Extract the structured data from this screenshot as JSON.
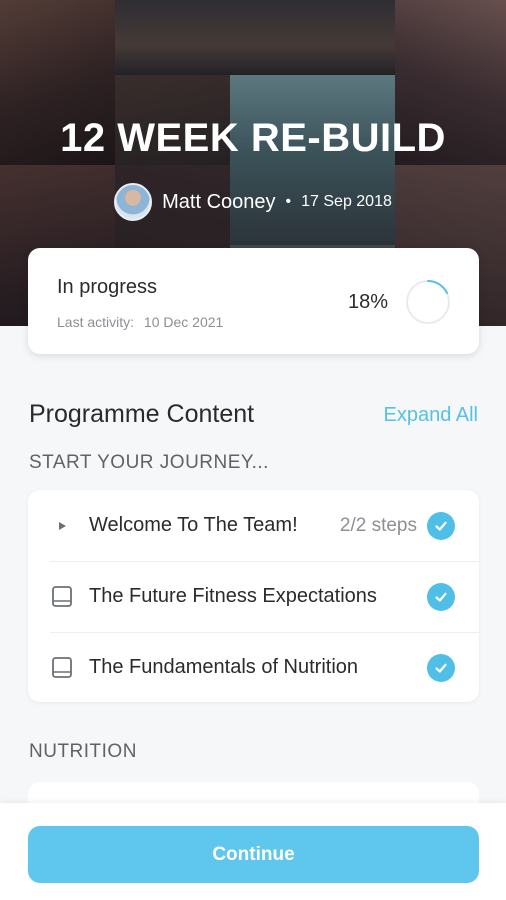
{
  "programme": {
    "title": "12 WEEK RE-BUILD",
    "author_name": "Matt Cooney",
    "separator": "•",
    "date": "17 Sep 2018"
  },
  "progress": {
    "status": "In progress",
    "last_activity_label": "Last activity:",
    "last_activity_date": "10 Dec 2021",
    "percent_label": "18%",
    "percent_value": 0.18
  },
  "content": {
    "heading": "Programme Content",
    "expand_all": "Expand All",
    "groups": [
      {
        "label": "START YOUR JOURNEY...",
        "items": [
          {
            "icon": "play-icon",
            "label": "Welcome To The Team!",
            "steps": "2/2 steps",
            "completed": true
          },
          {
            "icon": "book-icon",
            "label": "The Future Fitness Expectations",
            "completed": true
          },
          {
            "icon": "book-icon",
            "label": "The Fundamentals of Nutrition",
            "completed": true
          }
        ]
      },
      {
        "label": "NUTRITION"
      }
    ]
  },
  "footer": {
    "continue_label": "Continue"
  },
  "colors": {
    "accent": "#55c1e6",
    "button": "#5fc7ee",
    "check": "#4fbfe7"
  }
}
